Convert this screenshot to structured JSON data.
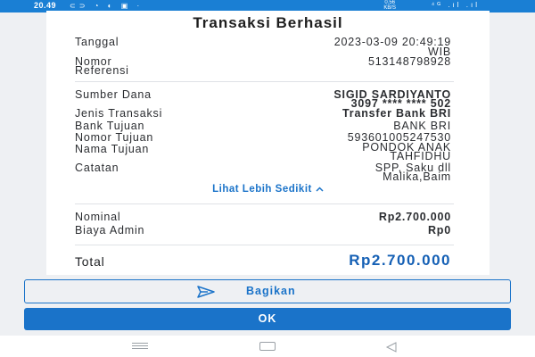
{
  "status_bar": {
    "time": "20.49",
    "left_icons": "⊂⊃ ◔ ◐ ▣ ·",
    "net_speed_value": "0.56",
    "net_speed_unit": "KB/S",
    "right_icons": "⁴ᴳ .ıl .ıl"
  },
  "receipt": {
    "title": "Transaksi Berhasil",
    "tanggal": {
      "label": "Tanggal",
      "value_line1": "2023-03-09 20:49:19",
      "value_line2": "WIB"
    },
    "referensi": {
      "label_line1": "Nomor",
      "label_line2": "Referensi",
      "value": "513148798928"
    },
    "sumber_dana": {
      "label": "Sumber Dana",
      "value_line1": "SIGID SARDIYANTO",
      "value_line2": "3097 **** **** 502"
    },
    "jenis_transaksi": {
      "label": "Jenis Transaksi",
      "value": "Transfer Bank BRI"
    },
    "bank_tujuan": {
      "label": "Bank Tujuan",
      "value": "BANK BRI"
    },
    "nomor_tujuan": {
      "label": "Nomor Tujuan",
      "value": "593601005247530"
    },
    "nama_tujuan": {
      "label": "Nama Tujuan",
      "value_line1": "PONDOK ANAK",
      "value_line2": "TAHFIDHU"
    },
    "catatan": {
      "label": "Catatan",
      "value_line1": "SPP, Saku dll",
      "value_line2": "Malika,Baim"
    },
    "toggle_link": "Lihat Lebih Sedikit",
    "nominal": {
      "label": "Nominal",
      "value": "Rp2.700.000"
    },
    "biaya_admin": {
      "label": "Biaya Admin",
      "value": "Rp0"
    },
    "total": {
      "label": "Total",
      "value": "Rp2.700.000"
    }
  },
  "buttons": {
    "share_label": "Bagikan",
    "ok_label": "OK"
  },
  "colors": {
    "accent": "#1a73c9",
    "total_text": "#1560b5",
    "status_bar": "#1a7fd4",
    "background": "#eef0f3"
  },
  "icons": {
    "share": "send-icon",
    "toggle": "chevron-up-icon",
    "nav_menu": "recent-apps-icon",
    "nav_home": "home-icon",
    "nav_back": "back-icon"
  }
}
